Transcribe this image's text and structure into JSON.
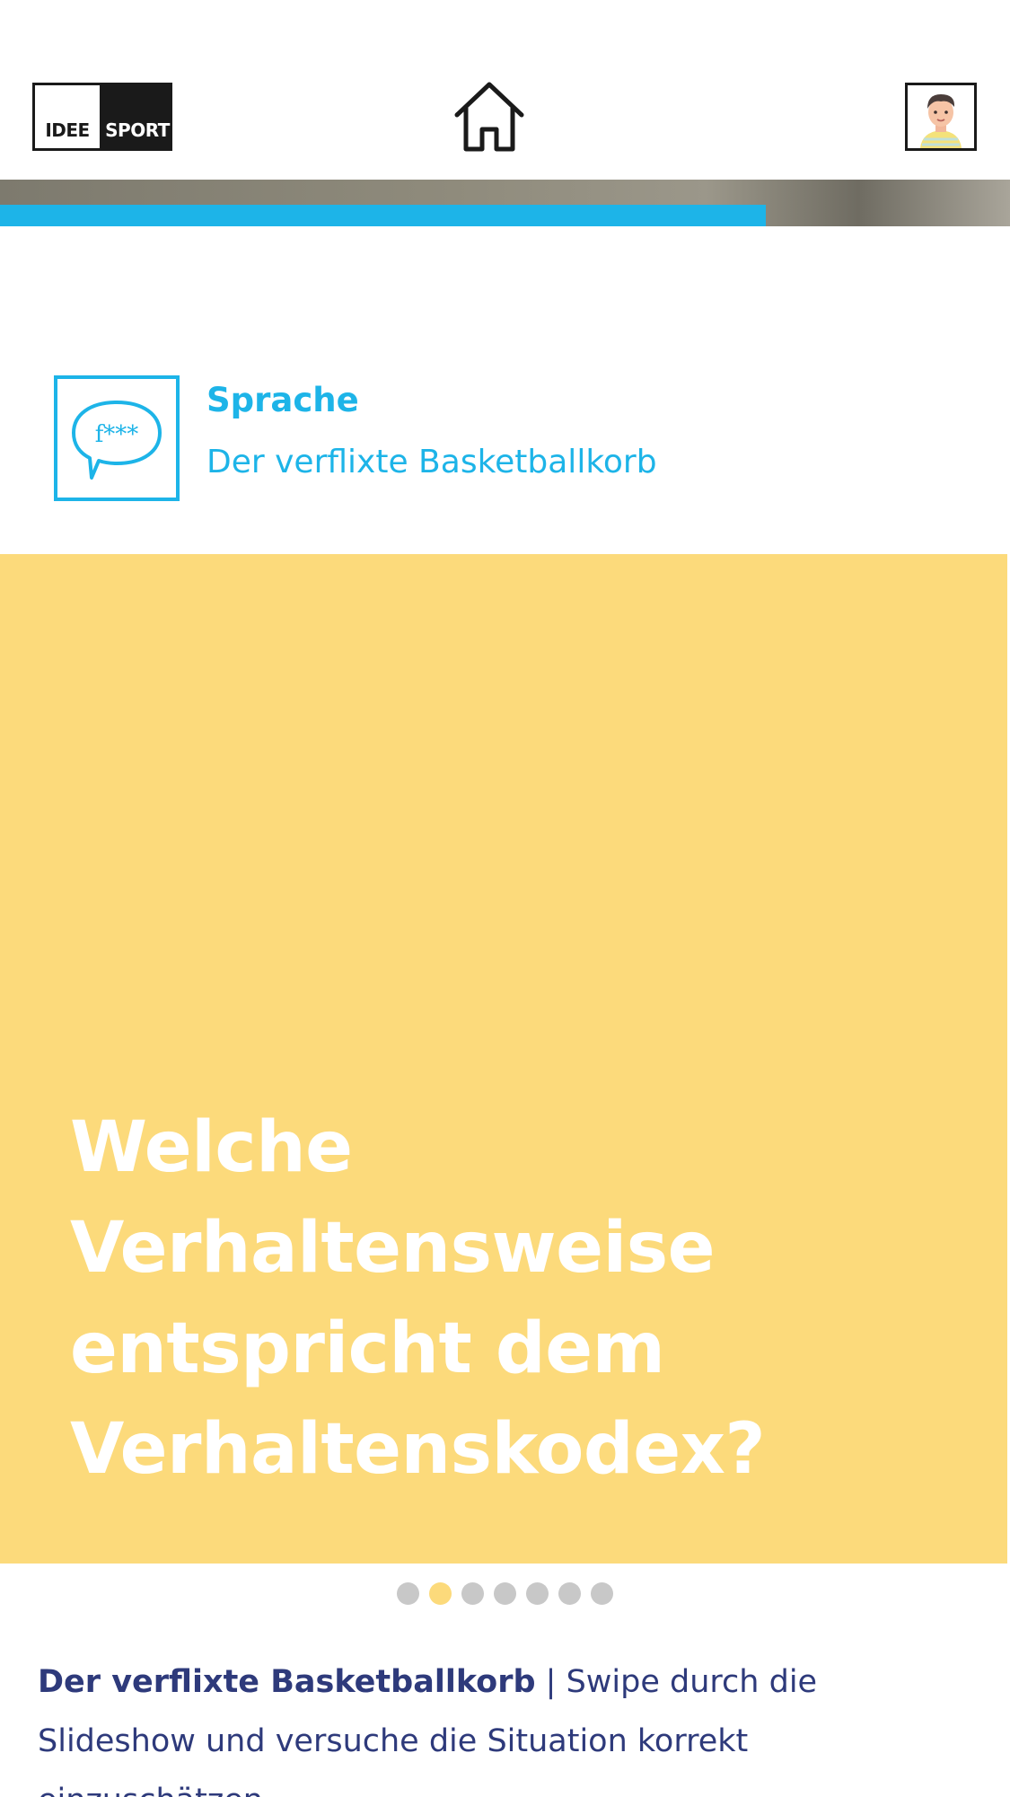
{
  "header": {
    "logo": {
      "part1": "IDEE",
      "part2": "SPORT"
    },
    "home_icon": "home-icon",
    "avatar_icon": "avatar-boy-icon"
  },
  "progress": {
    "value_percent": 75.8,
    "color": "#1db4e8"
  },
  "topic": {
    "icon": "speech-bubble-censored-icon",
    "icon_text": "f***",
    "category": "Sprache",
    "title": "Der verflixte Basketballkorb"
  },
  "slide": {
    "background": "#fcda7b",
    "question_lines": [
      "Welche",
      "Verhaltensweise",
      "entspricht dem",
      "Verhaltenskodex?"
    ]
  },
  "carousel": {
    "total": 7,
    "active_index": 1
  },
  "caption": {
    "title": "Der verflixte Basketballkorb",
    "separator": "|",
    "text": "Swipe durch die Slideshow und versuche die Situation korrekt einzuschätzen."
  },
  "colors": {
    "accent": "#1db4e8",
    "text_dark": "#2e3a7b",
    "dot_inactive": "#c8c8c8"
  }
}
